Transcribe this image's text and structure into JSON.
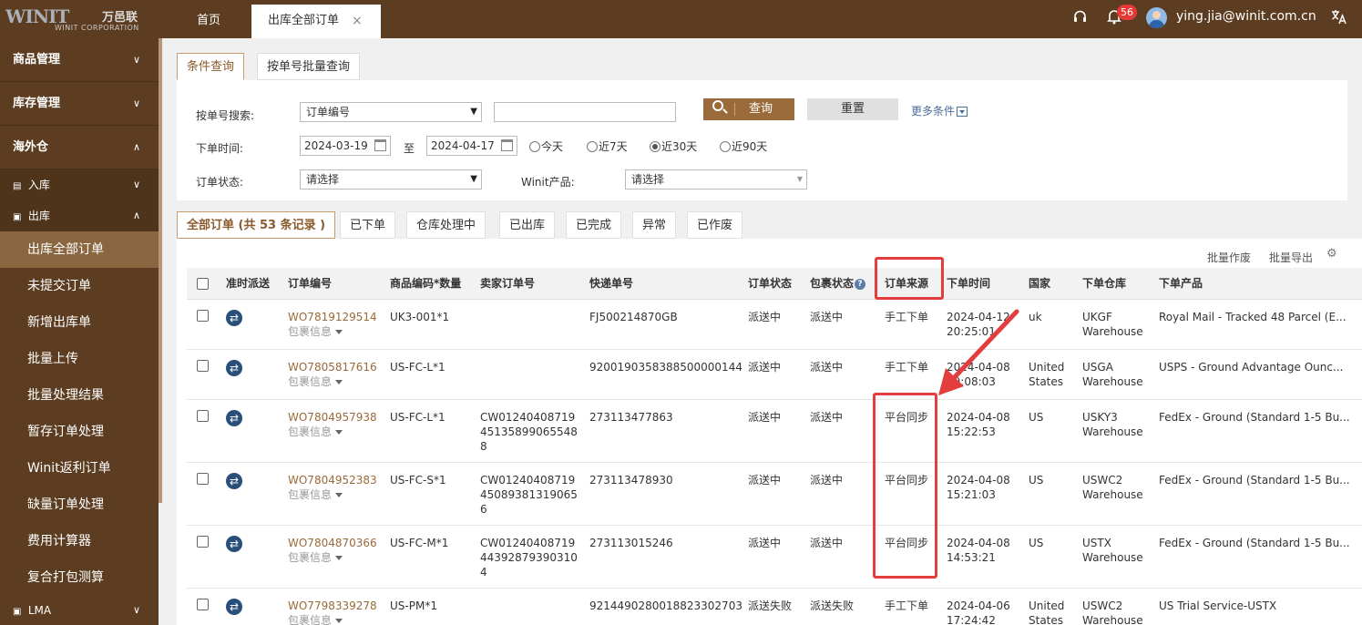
{
  "brand": {
    "logo_main": "WINIT",
    "logo_cn": "万邑联",
    "logo_sub": "WINIT CORPORATION"
  },
  "top_tabs": {
    "home": "首页",
    "active": "出库全部订单",
    "close": "×"
  },
  "topbar": {
    "notifications": "56",
    "user_email": "ying.jia@winit.com.cn"
  },
  "sidebar": {
    "groups": [
      {
        "label": "商品管理",
        "chevron": "∨"
      },
      {
        "label": "库存管理",
        "chevron": "∨"
      },
      {
        "label": "海外仓",
        "chevron": "∧"
      }
    ],
    "subgroups": [
      {
        "label": "入库",
        "chevron": "∨"
      },
      {
        "label": "出库",
        "chevron": "∧"
      }
    ],
    "items": [
      "出库全部订单",
      "未提交订单",
      "新增出库单",
      "批量上传",
      "批量处理结果",
      "暂存订单处理",
      "Winit返利订单",
      "缺量订单处理",
      "费用计算器",
      "复合打包测算"
    ],
    "lma": {
      "label": "LMA",
      "chevron": "∨"
    }
  },
  "query_tabs": [
    "条件查询",
    "按单号批量查询"
  ],
  "filters": {
    "search_label": "按单号搜索:",
    "search_type": "订单编号",
    "search_value": "",
    "query_button": "查询",
    "reset_button": "重置",
    "more_conditions": "更多条件",
    "date_label": "下单时间:",
    "date_from": "2024-03-19",
    "date_to_label": "至",
    "date_to": "2024-04-17",
    "quick_ranges": [
      "今天",
      "近7天",
      "近30天",
      "近90天"
    ],
    "quick_selected": "近30天",
    "status_label": "订单状态:",
    "status_value": "请选择",
    "product_label": "Winit产品:",
    "product_value": "请选择"
  },
  "status_tabs": {
    "all_prefix": "全部订单 (",
    "all_mid": "共 ",
    "all_count": "53",
    "all_suffix": " 条记录 )",
    "others": [
      "已下单",
      "仓库处理中",
      "已出库",
      "已完成",
      "异常",
      "已作废"
    ]
  },
  "bulk_actions": [
    "批量作废",
    "批量导出"
  ],
  "table": {
    "columns": [
      "准时派送",
      "订单编号",
      "商品编码*数量",
      "卖家订单号",
      "快递单号",
      "订单状态",
      "包裹状态",
      "订单来源",
      "下单时间",
      "国家",
      "下单仓库",
      "下单产品"
    ],
    "package_info_label": "包裹信息",
    "rows": [
      {
        "order_no": "WO7819129514",
        "sku": "UK3-001*1",
        "seller_no": [],
        "tracking": "FJ500214870GB",
        "status": "派送中",
        "pkg_status": "派送中",
        "source": "手工下单",
        "time": [
          "2024-04-12",
          "20:25:01"
        ],
        "country": [
          "uk"
        ],
        "warehouse": [
          "UKGF",
          "Warehouse"
        ],
        "product": "Royal Mail - Tracked 48 Parcel (E..."
      },
      {
        "order_no": "WO7805817616",
        "sku": "US-FC-L*1",
        "seller_no": [],
        "tracking": "9200190358388500000144",
        "status": "派送中",
        "pkg_status": "派送中",
        "source": "手工下单",
        "time": [
          "2024-04-08",
          "09:08:03"
        ],
        "country": [
          "United",
          "States"
        ],
        "warehouse": [
          "USGA",
          "Warehouse"
        ],
        "product": "USPS - Ground Advantage Ounc..."
      },
      {
        "order_no": "WO7804957938",
        "sku": "US-FC-L*1",
        "seller_no": [
          "CW01240408719",
          "45135899065548",
          "8"
        ],
        "tracking": "273113477863",
        "status": "派送中",
        "pkg_status": "派送中",
        "source": "平台同步",
        "time": [
          "2024-04-08",
          "15:22:53"
        ],
        "country": [
          "US"
        ],
        "warehouse": [
          "USKY3",
          "Warehouse"
        ],
        "product": "FedEx - Ground (Standard 1-5 Bu..."
      },
      {
        "order_no": "WO7804952383",
        "sku": "US-FC-S*1",
        "seller_no": [
          "CW01240408719",
          "45089381319065",
          "6"
        ],
        "tracking": "273113478930",
        "status": "派送中",
        "pkg_status": "派送中",
        "source": "平台同步",
        "time": [
          "2024-04-08",
          "15:21:03"
        ],
        "country": [
          "US"
        ],
        "warehouse": [
          "USWC2",
          "Warehouse"
        ],
        "product": "FedEx - Ground (Standard 1-5 Bu..."
      },
      {
        "order_no": "WO7804870366",
        "sku": "US-FC-M*1",
        "seller_no": [
          "CW01240408719",
          "44392879390310",
          "4"
        ],
        "tracking": "273113015246",
        "status": "派送中",
        "pkg_status": "派送中",
        "source": "平台同步",
        "time": [
          "2024-04-08",
          "14:53:21"
        ],
        "country": [
          "US"
        ],
        "warehouse": [
          "USTX",
          "Warehouse"
        ],
        "product": "FedEx - Ground (Standard 1-5 Bu..."
      },
      {
        "order_no": "WO7798339278",
        "sku": "US-PM*1",
        "seller_no": [],
        "tracking": "9214490280018823302703",
        "status": "派送失败",
        "pkg_status": "派送失败",
        "source": "手工下单",
        "time": [
          "2024-04-06",
          "17:24:42"
        ],
        "country": [
          "United",
          "States"
        ],
        "warehouse": [
          "USWC2",
          "Warehouse"
        ],
        "product": "US Trial Service-USTX"
      }
    ]
  },
  "colors": {
    "brand_brown": "#5c3d21",
    "accent": "#9a6a3a",
    "highlight_red": "#e43d3d",
    "link_blue": "#4a6e9a"
  }
}
